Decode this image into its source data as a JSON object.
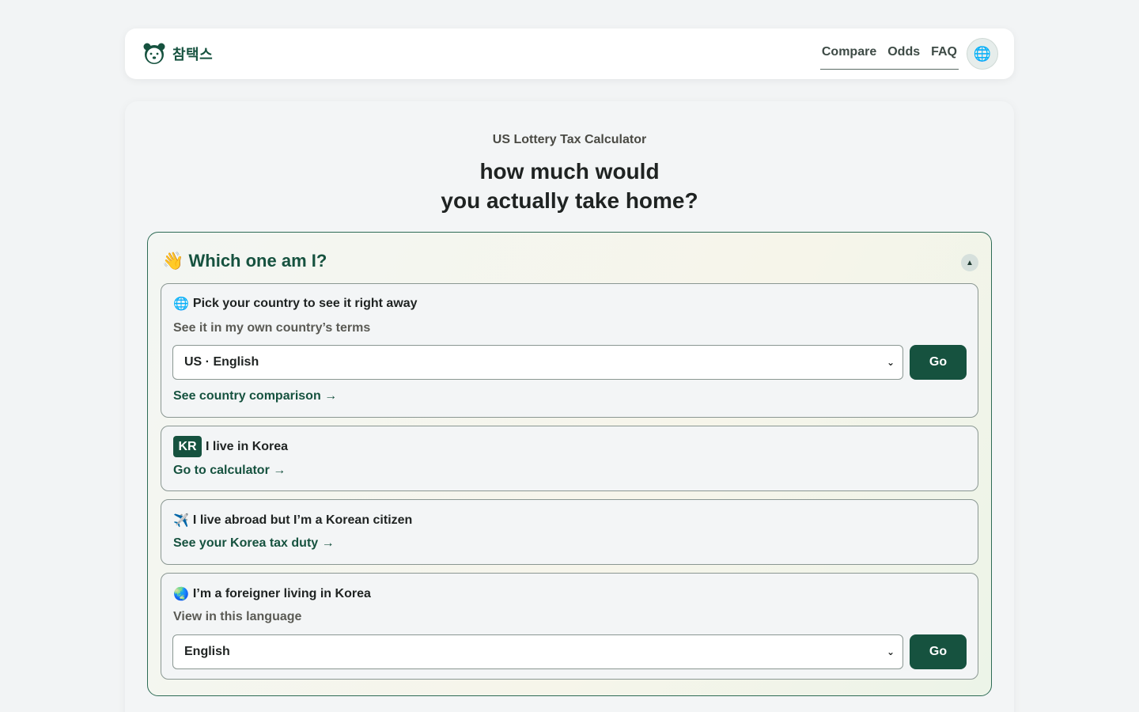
{
  "header": {
    "brand_name": "참택스",
    "logo_icon": "bear-face-icon",
    "nav": [
      "Compare",
      "Odds",
      "FAQ"
    ],
    "language_icon": "globe-icon",
    "language_glyph": "🌐"
  },
  "hero": {
    "subtitle": "US Lottery Tax Calculator",
    "headline_line1": "how much would",
    "headline_line2": "you actually take home?"
  },
  "chooser": {
    "title": "👋 Which one am I?",
    "collapse_glyph": "▲",
    "options": [
      {
        "icon": "🌐",
        "title": "Pick your country to see it right away",
        "subtitle": "See it in my own country’s terms",
        "select_value": "US · English",
        "go_label": "Go",
        "link": "See country comparison →"
      },
      {
        "badge": "KR",
        "title": "I live in Korea",
        "link": "Go to calculator →"
      },
      {
        "icon": "✈️",
        "title": "I live abroad but I’m a Korean citizen",
        "link": "See your Korea tax duty →"
      },
      {
        "icon": "🌏",
        "title": "I’m a foreigner living in Korea",
        "subtitle": "View in this language",
        "select_value": "English",
        "go_label": "Go"
      }
    ]
  },
  "colors": {
    "brand": "#16523f",
    "background": "#f2f4f5",
    "card": "#ffffff"
  }
}
